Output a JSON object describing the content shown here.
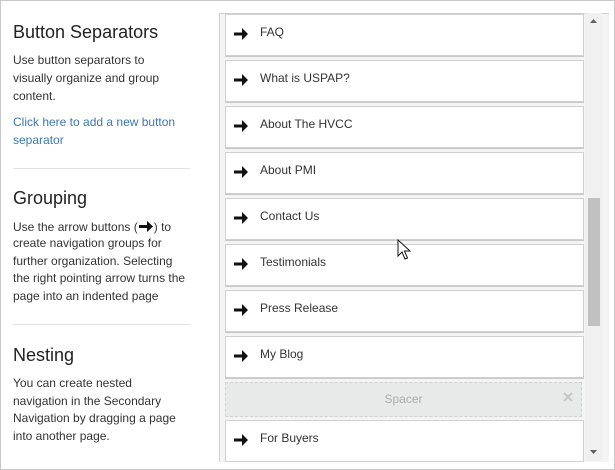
{
  "help": {
    "button_separators": {
      "title": "Button Separators",
      "body": [
        "Use button separators to",
        "visually organize and group",
        "content."
      ],
      "link": [
        "Click here to add a new button",
        "separator"
      ]
    },
    "grouping": {
      "title": "Grouping",
      "body_prefix": "Use the arrow buttons (",
      "body_suffix": ") to",
      "body": [
        "create navigation groups for",
        "further organization. Selecting",
        "the right pointing arrow turns the",
        "page into an indented page"
      ]
    },
    "nesting": {
      "title": "Nesting",
      "body": [
        "You can create nested",
        "navigation in the Secondary",
        "Navigation by dragging a page",
        "into another page."
      ]
    }
  },
  "nav": {
    "items": [
      {
        "label": "FAQ"
      },
      {
        "label": "What is USPAP?"
      },
      {
        "label": "About The HVCC"
      },
      {
        "label": "About PMI"
      },
      {
        "label": "Contact Us"
      },
      {
        "label": "Testimonials"
      },
      {
        "label": "Press Release"
      },
      {
        "label": "My Blog"
      }
    ],
    "spacer": {
      "label": "Spacer",
      "close_icon": "close-icon"
    },
    "after_spacer": [
      {
        "label": "For Buyers"
      }
    ],
    "arrow_icon": "arrow-right-icon"
  },
  "colors": {
    "link": "#3a77b7",
    "panel_bg": "#f4f4f4",
    "spacer_bg": "#e8eaea"
  }
}
